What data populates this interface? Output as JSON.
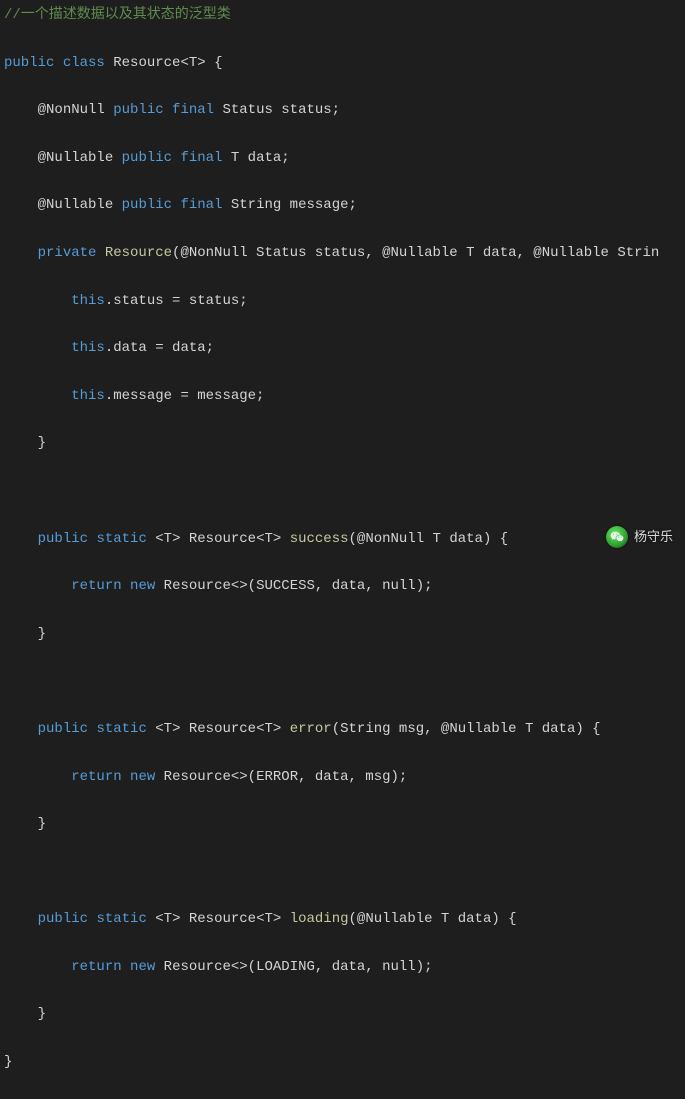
{
  "code": {
    "comment": "//一个描述数据以及其状态的泛型类",
    "l1": {
      "k1": "public",
      "k2": "class",
      "name": "Resource<T> {"
    },
    "l2": {
      "anno": "@NonNull",
      "mods": "public final",
      "rest": "Status status;"
    },
    "l3": {
      "anno": "@Nullable",
      "mods": "public final",
      "rest": "T data;"
    },
    "l4": {
      "anno": "@Nullable",
      "mods": "public final",
      "rest": "String message;"
    },
    "l5": {
      "k": "private",
      "m": "Resource",
      "sig": "(@NonNull Status status, @Nullable T data, @Nullable Strin"
    },
    "l6": {
      "k": "this",
      "rest": ".status = status;"
    },
    "l7": {
      "k": "this",
      "rest": ".data = data;"
    },
    "l8": {
      "k": "this",
      "rest": ".message = message;"
    },
    "closeBrace": "}",
    "l10": {
      "k1": "public",
      "k2": "static",
      "gen": "<T> Resource<T>",
      "m": "success",
      "sig": "(@NonNull T data) {"
    },
    "l11": {
      "k1": "return",
      "k2": "new",
      "rest": "Resource<>(SUCCESS, data, null);"
    },
    "l13": {
      "k1": "public",
      "k2": "static",
      "gen": "<T> Resource<T>",
      "m": "error",
      "sig": "(String msg, @Nullable T data) {"
    },
    "l14": {
      "k1": "return",
      "k2": "new",
      "rest": "Resource<>(ERROR, data, msg);"
    },
    "l16": {
      "k1": "public",
      "k2": "static",
      "gen": "<T> Resource<T>",
      "m": "loading",
      "sig": "(@Nullable T data) {"
    },
    "l17": {
      "k1": "return",
      "k2": "new",
      "rest": "Resource<>(LOADING, data, null);"
    },
    "finalClose": "}"
  },
  "watermark": {
    "name": "杨守乐"
  }
}
